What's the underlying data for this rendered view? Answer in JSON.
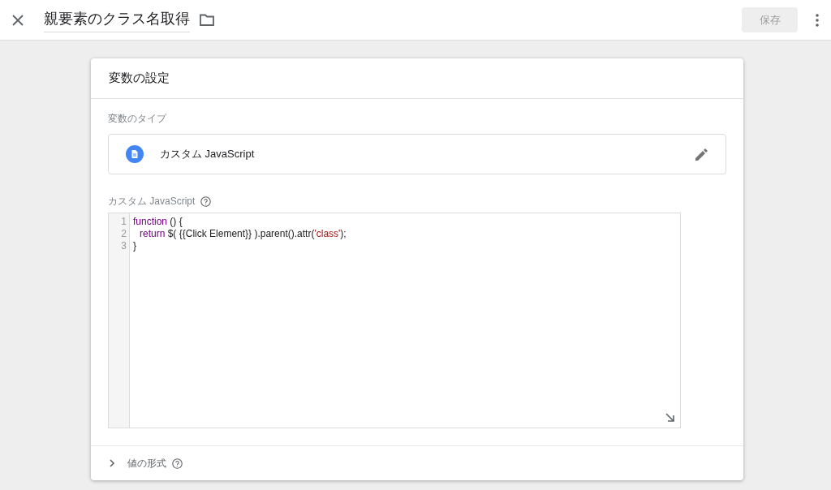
{
  "top_bar": {
    "title": "親要素のクラス名取得",
    "save_button": {
      "label": "保存",
      "disabled": true
    }
  },
  "card": {
    "title": "変数の設定",
    "variable_type": {
      "label": "変数のタイプ",
      "value": "カスタム JavaScript"
    },
    "code_editor": {
      "label": "カスタム JavaScript",
      "lines": [
        {
          "number": "1",
          "tokens": [
            {
              "kind": "keyword",
              "text": "function"
            },
            {
              "kind": "plain",
              "text": " () {"
            }
          ]
        },
        {
          "number": "2",
          "indented": true,
          "tokens": [
            {
              "kind": "keyword",
              "text": "return"
            },
            {
              "kind": "plain",
              "text": " $( {{Click Element}} ).parent().attr("
            },
            {
              "kind": "string",
              "text": "'class'"
            },
            {
              "kind": "plain",
              "text": ");"
            }
          ]
        },
        {
          "number": "3",
          "tokens": [
            {
              "kind": "plain",
              "text": "}"
            }
          ]
        }
      ]
    },
    "format_section": {
      "label": "値の形式",
      "expanded": false
    }
  }
}
